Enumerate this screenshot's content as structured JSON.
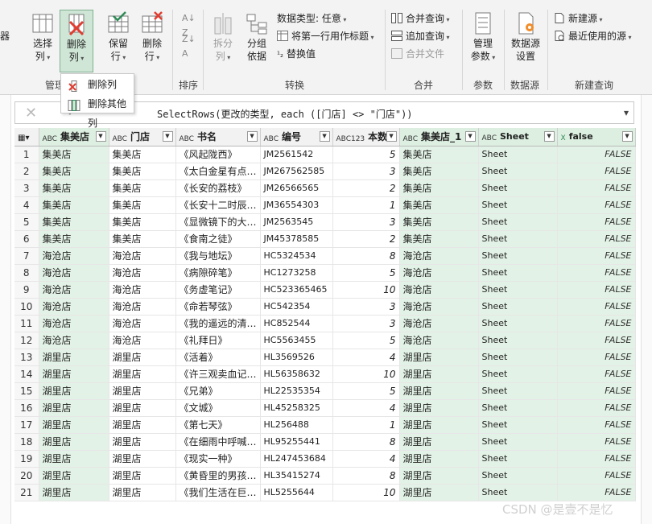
{
  "ribbon": {
    "cut_left": "器",
    "groups": {
      "manage_cols": "管理",
      "sort": "排序",
      "transform": "转换",
      "combine": "合并",
      "params": "参数",
      "datasource": "数据源",
      "new_query": "新建查询"
    },
    "buttons": {
      "choose_cols": [
        "选择",
        "列"
      ],
      "remove_cols": [
        "删除",
        "列"
      ],
      "keep_rows": [
        "保留",
        "行"
      ],
      "remove_rows": [
        "删除",
        "行"
      ],
      "split": [
        "拆分",
        "列"
      ],
      "group_by": [
        "分组",
        "依据"
      ],
      "manage_params": [
        "管理",
        "参数"
      ],
      "datasource_settings": [
        "数据源",
        "设置"
      ]
    },
    "small_buttons": {
      "data_type": "数据类型: 任意",
      "first_row_header": "将第一行用作标题",
      "replace_values": "替换值",
      "merge_queries": "合并查询",
      "append_queries": "追加查询",
      "combine_files": "合并文件",
      "new_source": "新建源",
      "recent_sources": "最近使用的源"
    },
    "menu": {
      "remove_cols": "删除列",
      "remove_other_cols": "删除其他列"
    }
  },
  "formula_bar": {
    "formula": "SelectRows(更改的类型, each ([门店] <> \"门店\"))"
  },
  "table": {
    "columns": [
      {
        "name": "集美店",
        "type": "ABC"
      },
      {
        "name": "门店",
        "type": "ABC"
      },
      {
        "name": "书名",
        "type": "ABC"
      },
      {
        "name": "编号",
        "type": "ABC"
      },
      {
        "name": "本数",
        "type": "ABC123"
      },
      {
        "name": "集美店_1",
        "type": "ABC"
      },
      {
        "name": "Sheet",
        "type": "ABC"
      },
      {
        "name": "false",
        "type": "X"
      }
    ],
    "rows": [
      [
        "1",
        "集美店",
        "集美店",
        "《风起陇西》",
        "JM2561542",
        "5",
        "集美店",
        "Sheet",
        "FALSE"
      ],
      [
        "2",
        "集美店",
        "集美店",
        "《太白金星有点…",
        "JM267562585",
        "3",
        "集美店",
        "Sheet",
        "FALSE"
      ],
      [
        "3",
        "集美店",
        "集美店",
        "《长安的荔枝》",
        "JM26566565",
        "2",
        "集美店",
        "Sheet",
        "FALSE"
      ],
      [
        "4",
        "集美店",
        "集美店",
        "《长安十二时辰…",
        "JM36554303",
        "1",
        "集美店",
        "Sheet",
        "FALSE"
      ],
      [
        "5",
        "集美店",
        "集美店",
        "《显微镜下的大…",
        "JM2563545",
        "3",
        "集美店",
        "Sheet",
        "FALSE"
      ],
      [
        "6",
        "集美店",
        "集美店",
        "《食南之徒》",
        "JM45378585",
        "2",
        "集美店",
        "Sheet",
        "FALSE"
      ],
      [
        "7",
        "海沧店",
        "海沧店",
        "《我与地坛》",
        "HC5324534",
        "8",
        "海沧店",
        "Sheet",
        "FALSE"
      ],
      [
        "8",
        "海沧店",
        "海沧店",
        "《病隙碎笔》",
        "HC1273258",
        "5",
        "海沧店",
        "Sheet",
        "FALSE"
      ],
      [
        "9",
        "海沧店",
        "海沧店",
        "《务虚笔记》",
        "HC523365465",
        "10",
        "海沧店",
        "Sheet",
        "FALSE"
      ],
      [
        "10",
        "海沧店",
        "海沧店",
        "《命若琴弦》",
        "HC542354",
        "3",
        "海沧店",
        "Sheet",
        "FALSE"
      ],
      [
        "11",
        "海沧店",
        "海沧店",
        "《我的遥远的清…",
        "HC852544",
        "3",
        "海沧店",
        "Sheet",
        "FALSE"
      ],
      [
        "12",
        "海沧店",
        "海沧店",
        "《礼拜日》",
        "HC5563455",
        "5",
        "海沧店",
        "Sheet",
        "FALSE"
      ],
      [
        "13",
        "湖里店",
        "湖里店",
        "《活着》",
        "HL3569526",
        "4",
        "湖里店",
        "Sheet",
        "FALSE"
      ],
      [
        "14",
        "湖里店",
        "湖里店",
        "《许三观卖血记…",
        "HL56358632",
        "10",
        "湖里店",
        "Sheet",
        "FALSE"
      ],
      [
        "15",
        "湖里店",
        "湖里店",
        "《兄弟》",
        "HL22535354",
        "5",
        "湖里店",
        "Sheet",
        "FALSE"
      ],
      [
        "16",
        "湖里店",
        "湖里店",
        "《文城》",
        "HL45258325",
        "4",
        "湖里店",
        "Sheet",
        "FALSE"
      ],
      [
        "17",
        "湖里店",
        "湖里店",
        "《第七天》",
        "HL256488",
        "1",
        "湖里店",
        "Sheet",
        "FALSE"
      ],
      [
        "18",
        "湖里店",
        "湖里店",
        "《在细雨中呼喊…",
        "HL95255441",
        "8",
        "湖里店",
        "Sheet",
        "FALSE"
      ],
      [
        "19",
        "湖里店",
        "湖里店",
        "《现实一种》",
        "HL247453684",
        "4",
        "湖里店",
        "Sheet",
        "FALSE"
      ],
      [
        "20",
        "湖里店",
        "湖里店",
        "《黄昏里的男孩…",
        "HL35415274",
        "8",
        "湖里店",
        "Sheet",
        "FALSE"
      ],
      [
        "21",
        "湖里店",
        "湖里店",
        "《我们生活在巨…",
        "HL5255644",
        "10",
        "湖里店",
        "Sheet",
        "FALSE"
      ]
    ]
  },
  "watermark": "CSDN @是壹不是忆",
  "colors": {
    "accent_green": "#2e8b57",
    "cell_green": "#e3f2e6",
    "delete_red": "#e03c31"
  }
}
